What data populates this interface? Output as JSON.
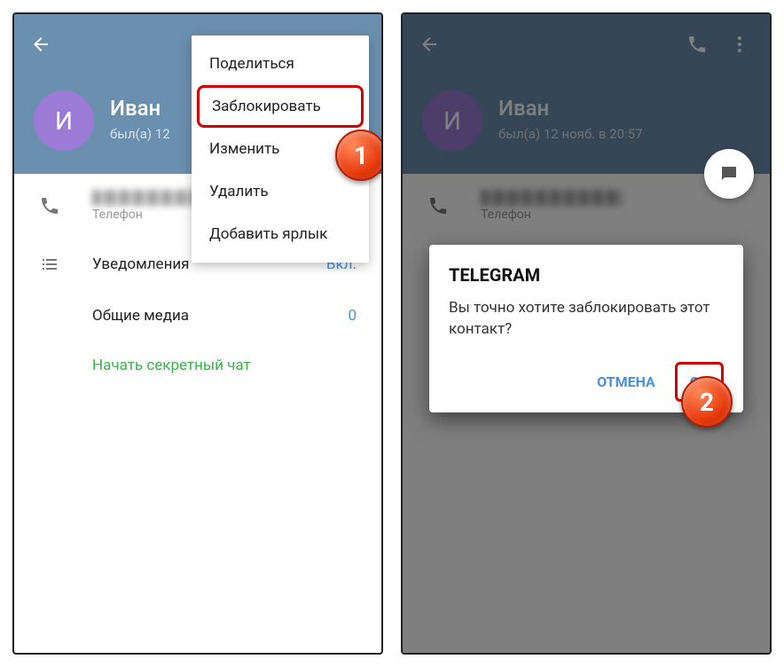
{
  "left": {
    "avatar_letter": "И",
    "name": "Иван",
    "status": "был(а) 12",
    "menu": {
      "share": "Поделиться",
      "block": "Заблокировать",
      "edit": "Изменить",
      "delete": "Удалить",
      "add_shortcut": "Добавить ярлык"
    },
    "phone_label": "Телефон",
    "notifications": {
      "label": "Уведомления",
      "value": "Вкл."
    },
    "media": {
      "label": "Общие медиа",
      "value": "0"
    },
    "secret_chat": "Начать секретный чат",
    "step": "1"
  },
  "right": {
    "avatar_letter": "И",
    "name": "Иван",
    "status": "был(а) 12 нояб. в 20:57",
    "phone_label": "Телефон",
    "dialog": {
      "title": "TELEGRAM",
      "message": "Вы точно хотите заблокировать этот контакт?",
      "cancel": "ОТМЕНА",
      "ok": "OK"
    },
    "step": "2"
  }
}
